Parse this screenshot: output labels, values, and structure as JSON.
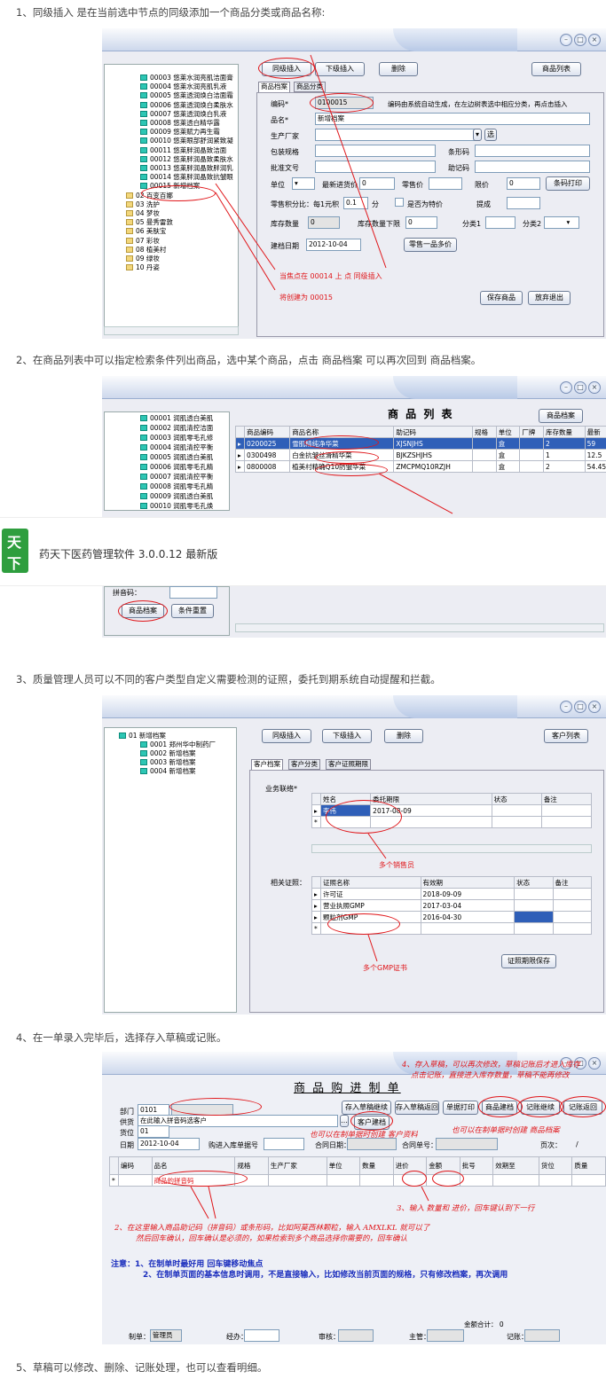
{
  "captions": [
    "1、同级插入 是在当前选中节点的同级添加一个商品分类或商品名称:",
    "2、在商品列表中可以指定检索条件列出商品，选中某个商品，点击 商品档案 可以再次回到 商品档案。",
    "3、质量管理人员可以不同的客户类型自定义需要检测的证照，委托到期系统自动提醒和拦截。",
    "4、在一单录入完毕后，选择存入草稿或记账。",
    "5、草稿可以修改、删除、记账处理，也可以查看明细。"
  ],
  "win1": {
    "tree": [
      "00003 悠莱水润亮肌洁面膏",
      "00004 悠莱水润亮肌乳液",
      "00005 悠莱透润焕白洁面霜",
      "00006 悠莱透润焕白柔肤水",
      "00007 悠莱透润焕白乳液",
      "00008 悠莱透白精华露",
      "00009 悠莱赋力再生霜",
      "00010 悠莱眼部舒润紧致凝",
      "00011 悠莱胖润晶致洁面",
      "00012 悠莱胖润晶致柔肤水",
      "00013 悠莱胖润晶致胖润乳",
      "00014 悠莱胖润晶致抗皱眼",
      "00015 新增档案",
      "02 百变百娜",
      "03 洗护",
      "04 梦妆",
      "05 曼秀雷敦",
      "06 美肤宝",
      "07 彩妆",
      "08 植美村",
      "09 绿妆",
      "10 丹姿"
    ],
    "buttons": [
      "同级插入",
      "下级插入",
      "删除",
      "商品列表"
    ],
    "tabs": [
      "商品档案",
      "商品分类"
    ],
    "labels": {
      "code": "编码*",
      "name": "品名*",
      "maker": "生产厂家",
      "spec": "包装规格",
      "barcode": "条形码",
      "approval": "批准文号",
      "mnemonic": "助记码",
      "unit": "单位",
      "last_price": "最新进货价",
      "retail": "零售价",
      "member_price": "限价",
      "print": "条码打印",
      "points": "零售积分比：每1元积",
      "points_unit": "分",
      "discount": "是否为特价",
      "bonus": "提成",
      "stock_qty": "库存数量",
      "stock_min": "库存数量下限",
      "cat1": "分类1",
      "cat2": "分类2",
      "date": "建档日期",
      "multi_price": "零售一品多价",
      "save": "保存商品",
      "cancel": "放弃退出",
      "select": "选"
    },
    "values": {
      "code": "0100015",
      "code_hint": "编码由系统自动生成，在左边树表选中相应分类，再点击插入",
      "name": "新增档案",
      "last_price": "0",
      "member_price": "0",
      "points": "0.1",
      "stock_qty": "0",
      "stock_min": "0",
      "date": "2012-10-04"
    },
    "notes": [
      "当焦点在 00014 上 点 同级插入",
      "将创建为 00015"
    ]
  },
  "win2": {
    "title": "商 品 列 表",
    "archive_btn": "商品档案",
    "tree": [
      "00001 润肌透白美肌",
      "00002 润肌清控洁面",
      "00003 润肌零毛孔修",
      "00004 润肌清控平衡",
      "00005 润肌透白美肌",
      "00006 润肌零毛孔精",
      "00007 润肌清控平衡",
      "00008 润肌零毛孔精",
      "00009 润肌透白美肌",
      "00010 润肌零毛孔焕"
    ],
    "columns": [
      "商品编码",
      "商品名称",
      "助记码",
      "规格",
      "单位",
      "厂牌",
      "库存数量",
      "最新"
    ],
    "rows": [
      [
        "0200025",
        "雪肌精纯净华菜",
        "XJSNJHS",
        "",
        "盒",
        "",
        "2",
        "59"
      ],
      [
        "0300498",
        "白金抗皱丝滑精华菜",
        "BJKZSHJHS",
        "",
        "盒",
        "",
        "1",
        "12.5"
      ],
      [
        "0800008",
        "植美村精确Q10防皱华菜",
        "ZMCPMQ10RZJH",
        "",
        "盒",
        "",
        "2",
        "54.45"
      ]
    ],
    "bottom_label": "拼音码：",
    "bottom_btns": [
      "商品档案",
      "条件重置"
    ]
  },
  "banner": {
    "title": "药天下医药管理软件 3.0.0.12 最新版",
    "logo": "天下"
  },
  "win3": {
    "tree": [
      "01 新增档案",
      "0001 郑州华中制药厂",
      "0002 新增档案",
      "0003 新增档案",
      "0004 新增档案"
    ],
    "buttons": [
      "同级插入",
      "下级插入",
      "删除",
      "客户列表"
    ],
    "tabs": [
      "客户档案",
      "客户分类",
      "客户证照期限"
    ],
    "sales_label": "业务联络*",
    "sales_cols": [
      "姓名",
      "委托期限",
      "状态",
      "备注"
    ],
    "sales_rows": [
      [
        "李伟",
        "2017-08-09",
        "",
        ""
      ]
    ],
    "note1": "多个销售员",
    "cert_label": "相关证照：",
    "cert_cols": [
      "证照名称",
      "有效期",
      "状态",
      "备注"
    ],
    "cert_rows": [
      [
        "许可证",
        "2018-09-09",
        "",
        ""
      ],
      [
        "营业执照GMP",
        "2017-03-04",
        "",
        ""
      ],
      [
        "颗粒剂GMP",
        "2016-04-30",
        "",
        ""
      ]
    ],
    "note2": "多个GMP证书",
    "save": "证照期限保存"
  },
  "win4": {
    "title": "商 品 购 进 制 单",
    "left_labels": [
      "部门",
      "供货",
      "货位",
      "日期"
    ],
    "left_values": [
      "0101",
      "在此输入拼音码选客户",
      "01",
      "2012-10-04"
    ],
    "buttons": [
      "存入草稿继续",
      "存入草稿返回",
      "单据打印",
      "商品建档",
      "记账继续",
      "记账返回"
    ],
    "client_btn": "客户建档",
    "extra_labels": [
      "购进入库单据号",
      "合同日期：",
      "合同单号：",
      "页次：",
      "/"
    ],
    "columns": [
      "编码",
      "品名",
      "规格",
      "生产厂家",
      "单位",
      "数量",
      "进价",
      "金额",
      "批号",
      "效期至",
      "货位",
      "质量"
    ],
    "row_name": "商品的拼音码",
    "hints": [
      "4、存入草稿，可以再次修改，草稿记账后才进入库存",
      "点击记账，直接进入库存数量，草稿不能再修改",
      "也可以在制单据时创建 客户资料",
      "也可以在制单据时创建 商品档案",
      "3、输入 数量和 进价，回车键认到下一行",
      "2、在这里输入商品助记码（拼音码）或条形码，比如阿莫西林颗粒，输入 AMXLKL 就可以了",
      "然后回车确认，回车确认是必须的，如果检索到多个商品选择你需要的，回车确认"
    ],
    "notice": [
      "注意：1、在制单时最好用 回车键移动焦点",
      "2、在制单页面的基本信息时调用，不是直接输入，比如修改当前页面的规格，只有修改档案，再次调用"
    ],
    "total": "金额合计： 0",
    "footer": [
      "制单：",
      "管理员",
      "经办：",
      "审核：",
      "主管：",
      "记账："
    ]
  }
}
